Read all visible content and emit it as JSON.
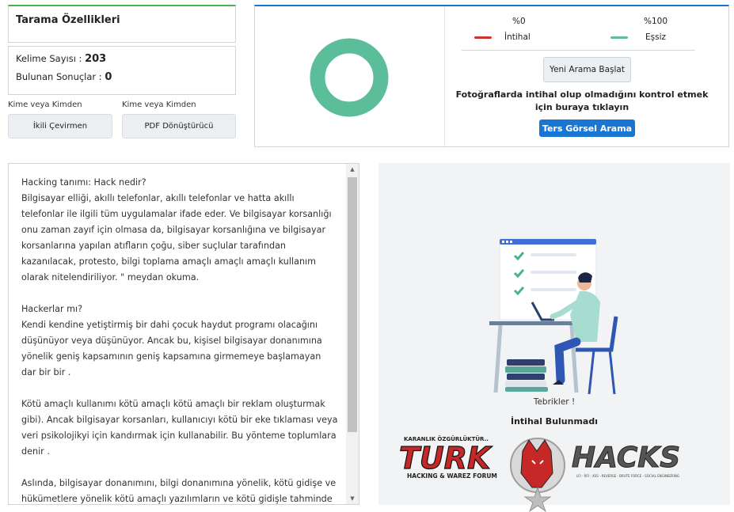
{
  "panel": {
    "title": "Tarama Özellikleri",
    "word_count_label": "Kelime Sayısı :",
    "word_count_value": "203",
    "results_found_label": "Bulunan Sonuçlar :",
    "results_found_value": "0",
    "label_left": "Kime veya Kimden",
    "label_right": "Kime veya Kimden",
    "btn_left": "İkili Çevirmen",
    "btn_right": "PDF Dönüştürücü"
  },
  "result": {
    "pct_plagiarism": "%0",
    "pct_unique": "%100",
    "legend_plagiarism": "İntihal",
    "legend_unique": "Eşsiz",
    "new_search_btn": "Yeni Arama Başlat",
    "photo_note": "Fotoğraflarda intihal olup olmadığını kontrol etmek için buraya tıklayın",
    "reverse_image_btn": "Ters Görsel Arama",
    "plagiarism_fraction": 0,
    "unique_fraction": 1
  },
  "colors": {
    "plagiarism": "#d32f2f",
    "unique": "#5bbd9a",
    "accent_blue": "#1976d2",
    "accent_green": "#4caf50"
  },
  "text": {
    "content": "Hacking tanımı: Hack nedir?\nBilgisayar elliği, akıllı telefonlar, akıllı telefonlar ve hatta akıllı telefonlar ile ilgili tüm uygulamalar ifade eder. Ve bilgisayar korsanlığı onu zaman zayıf için olmasa da, bilgisayar korsanlığına ve bilgisayar korsanlarına yapılan atıfların çoğu, siber suçlular tarafından kazanılacak, protesto, bilgi toplama amaçlı amaçlı amaçlı kullanım olarak nitelendiriliyor. \" meydan okuma.\n\nHackerlar mı?\nKendi kendine yetiştirmiş bir dahi çocuk haydut programı olacağını düşünüyor veya düşünüyor. Ancak bu, kişisel bilgisayar donanımına yönelik geniş kapsamının geniş kapsamına girmemeye başlamayan dar bir bir .\n\nKötü amaçlı kullanımı kötü amaçlı kötü amaçlı bir reklam oluşturmak gibi). Ancak bilgisayar korsanları, kullanıcıyı kötü bir eke tıklaması veya veri psikolojikyi için kandırmak için kullanabilir. Bu yönteme toplumlara denir .\n\nAslında, bilgisayar donanımını, bilgi donanımına yönelik, kötü gidişe ve hükümetlere yönelik kötü amaçlı yazılımların ve kötü gidişle tahminde"
  },
  "illustration": {
    "congrats": "Tebrikler !",
    "not_found": "İntihal Bulunmadı"
  },
  "watermark": {
    "brand_left": "TURK",
    "brand_right": "HACKS",
    "tagline": "HACKING & WAREZ FORUM",
    "top_small": "KARANLIK ÖZGÜRLÜKTÜR..",
    "right_small": "LFI - RFI - XSS - REVERSE - BRUTE FORCE - SOCIAL ENGINEERING"
  }
}
